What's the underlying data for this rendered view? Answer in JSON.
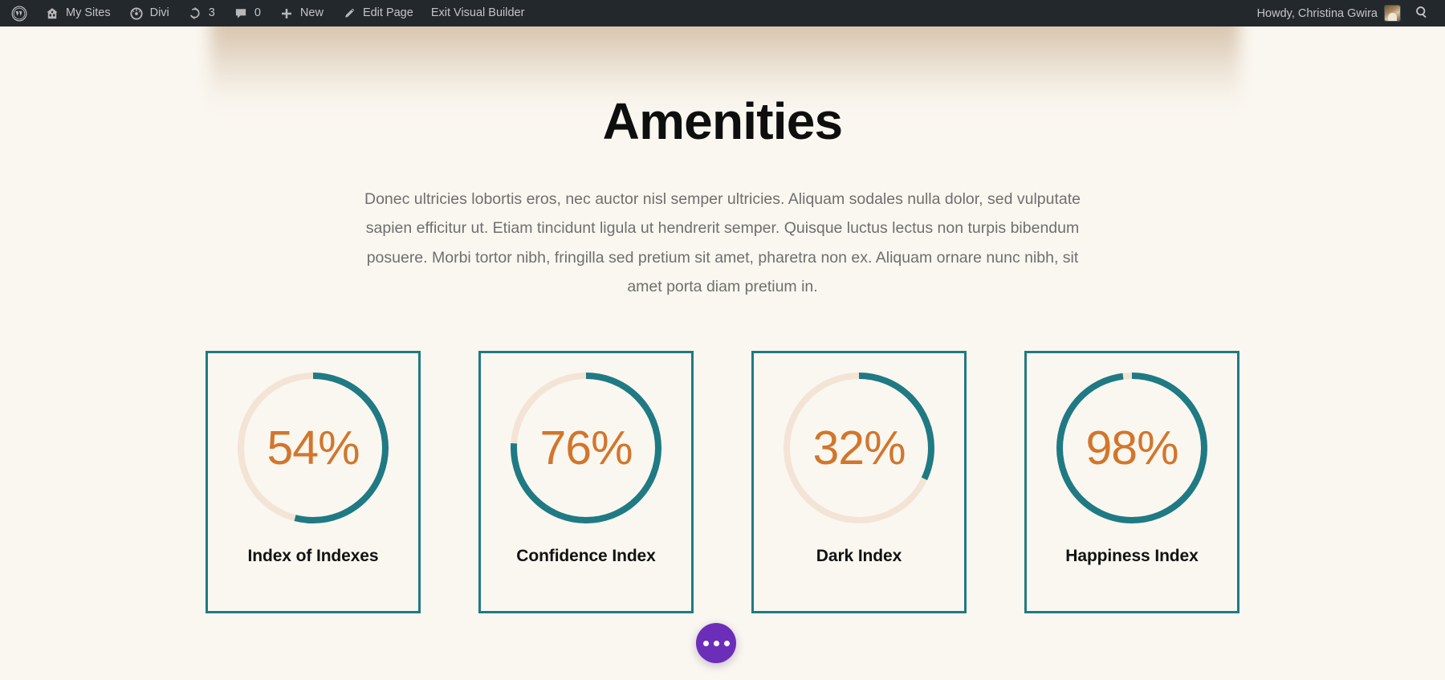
{
  "adminbar": {
    "wp_logo_label": "",
    "items": [
      {
        "name": "my-sites",
        "label": "My Sites",
        "icon": "sites-icon"
      },
      {
        "name": "divi",
        "label": "Divi",
        "icon": "divi-icon"
      },
      {
        "name": "updates",
        "label": "3",
        "icon": "updates-icon"
      },
      {
        "name": "comments",
        "label": "0",
        "icon": "comment-icon"
      },
      {
        "name": "new",
        "label": "New",
        "icon": "plus-icon"
      },
      {
        "name": "edit-page",
        "label": "Edit Page",
        "icon": "pencil-icon"
      },
      {
        "name": "exit-visual-builder",
        "label": "Exit Visual Builder",
        "icon": ""
      }
    ],
    "howdy": "Howdy, Christina Gwira",
    "search_icon": "search-icon"
  },
  "hero": {
    "title": "Amenities",
    "paragraph": "Donec ultricies lobortis eros, nec auctor nisl semper ultricies. Aliquam sodales nulla dolor, sed vulputate sapien efficitur ut. Etiam tincidunt ligula ut hendrerit semper. Quisque luctus lectus non turpis bibendum posuere. Morbi tortor nibh, fringilla sed pretium sit amet, pharetra non ex. Aliquam ornare nunc nibh, sit amet porta diam pretium in."
  },
  "chart_data": {
    "type": "pie",
    "title": "Amenities",
    "note": "Four circular percentage counters (radial donut gauges), each filled clockwise from 12 o'clock.",
    "categories": [
      "Index of Indexes",
      "Confidence Index",
      "Dark Index",
      "Happiness Index"
    ],
    "values": [
      54,
      76,
      32,
      98
    ],
    "value_labels": [
      "54%",
      "76%",
      "32%",
      "98%"
    ],
    "unit": "%",
    "ylim": [
      0,
      100
    ],
    "colors": {
      "progress": "#1f7a84",
      "track": "#f3e4d6",
      "value_text": "#d2762c",
      "card_border": "#1f7a84"
    }
  },
  "counters": [
    {
      "percent": "54%",
      "value": 54,
      "label": "Index of Indexes"
    },
    {
      "percent": "76%",
      "value": 76,
      "label": "Confidence Index"
    },
    {
      "percent": "32%",
      "value": 32,
      "label": "Dark Index"
    },
    {
      "percent": "98%",
      "value": 98,
      "label": "Happiness Index"
    }
  ],
  "fab": {
    "name": "divi-builder-menu",
    "icon": "ellipsis-icon",
    "color": "#6c2eb9"
  },
  "theme": {
    "background": "#faf7f0",
    "adminbar_bg": "#23282d",
    "adminbar_text": "#c3c4c7",
    "heading": "#0e0e0e",
    "body_text": "#6f6f6f"
  }
}
